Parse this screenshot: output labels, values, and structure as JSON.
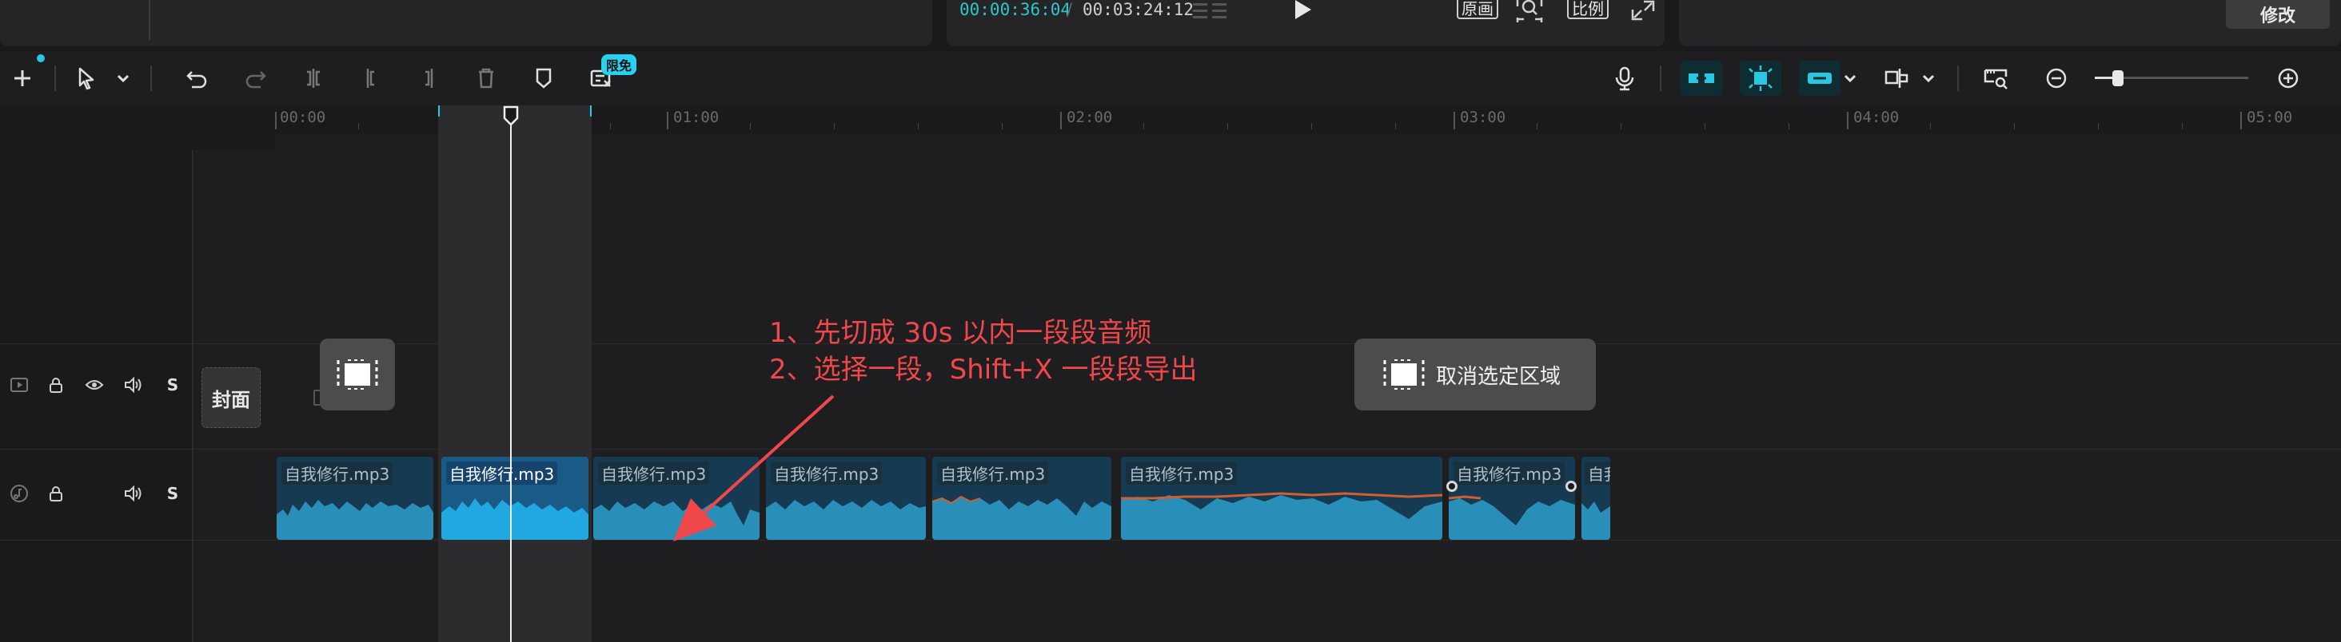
{
  "player": {
    "current_time": "00:00:36:04",
    "separator": "/",
    "total_time": "00:03:24:12",
    "buttons": [
      {
        "label": "原画"
      },
      {
        "label": "比例"
      }
    ]
  },
  "right_panel": {
    "modify_label": "修改"
  },
  "toolbar": {
    "promo_badge": "限免"
  },
  "ruler": {
    "ticks": [
      "00:00",
      "01:00",
      "02:00",
      "03:00",
      "04:00",
      "05:00"
    ]
  },
  "tracks": {
    "video": {
      "cover_label": "封面",
      "solo_label": "S"
    },
    "audio": {
      "solo_label": "S"
    }
  },
  "overlay": {
    "deselect_label": "取消选定区域"
  },
  "annotation": {
    "line1": "1、先切成 30s 以内一段段音频",
    "line2": "2、选择一段，Shift+X 一段段导出"
  },
  "clips": [
    {
      "label": "自我修行.mp3"
    },
    {
      "label": "自我修行.mp3"
    },
    {
      "label": "自我修行.mp3"
    },
    {
      "label": "自我修行.mp3"
    },
    {
      "label": "自我修行.mp3"
    },
    {
      "label": "自我修行.mp3"
    },
    {
      "label": "自我修行.mp3"
    },
    {
      "label": "自我"
    }
  ],
  "colors": {
    "accent": "#2ac8e0",
    "annotation": "#f0484a",
    "clip": "#153a52",
    "clip_selected": "#1a5a86",
    "waveform": "#2a8fb8",
    "peak": "#d06030"
  }
}
